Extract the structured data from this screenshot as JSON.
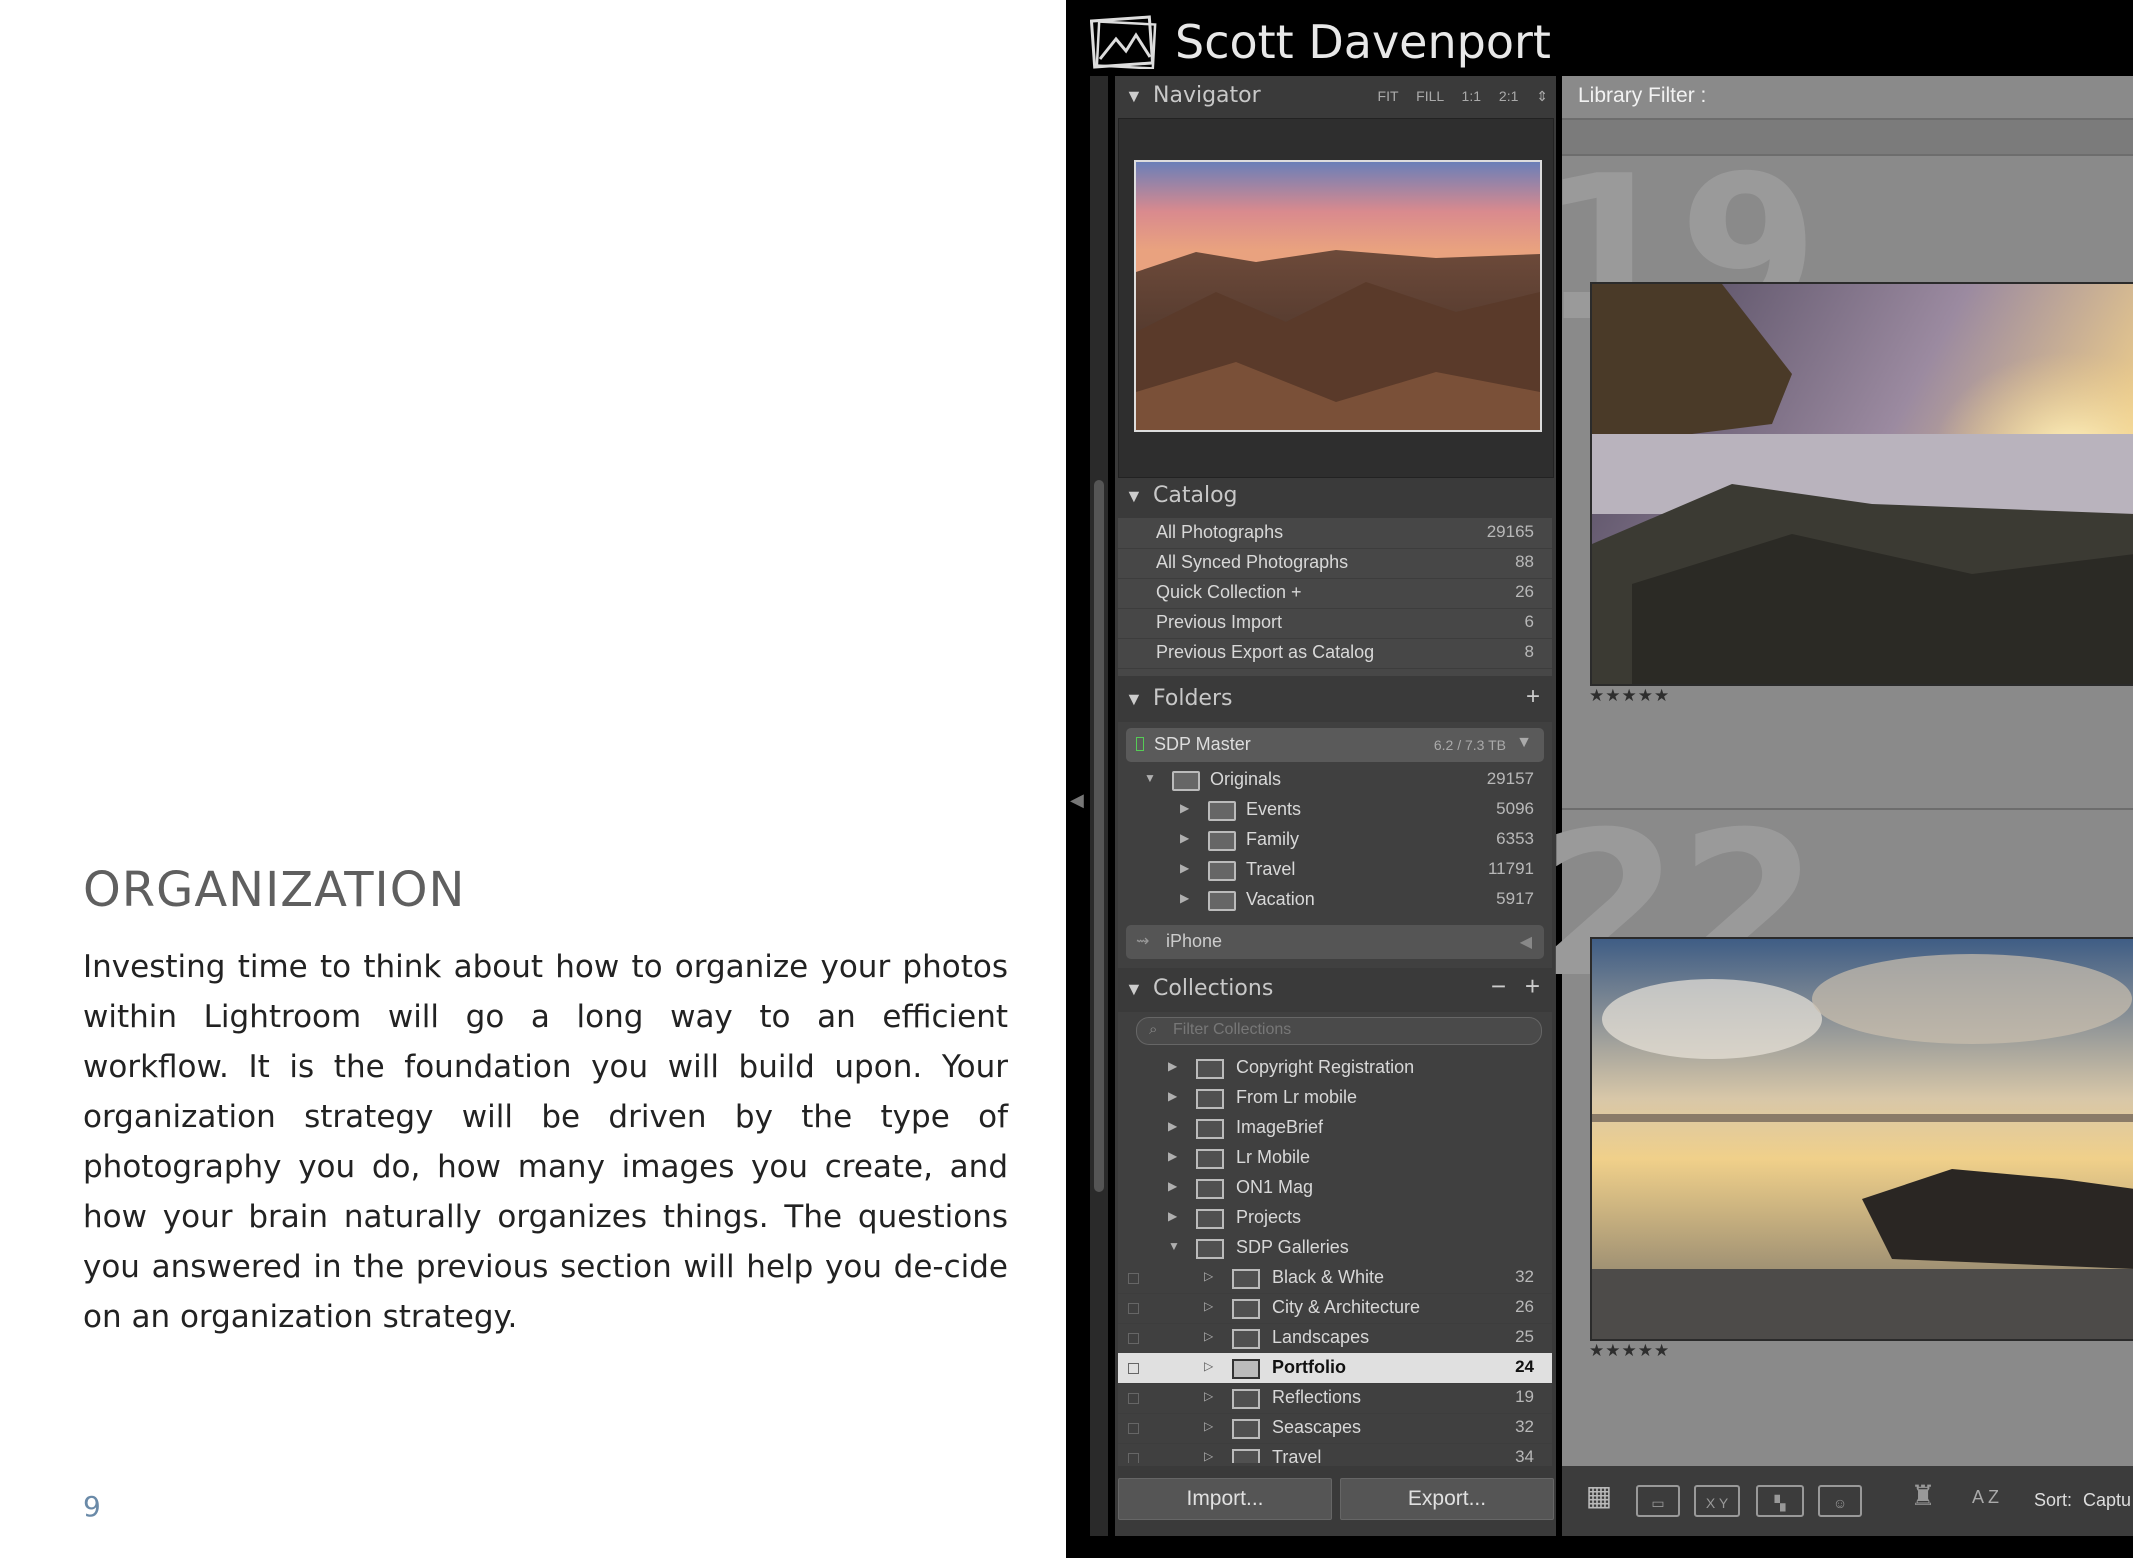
{
  "document": {
    "heading": "ORGANIZATION",
    "body": "Investing time to think about how to organize your photos within Lightroom will go a long way to an efficient workflow. It is the foundation you will build upon. Your organization strategy will be driven by the type of photography you do, how many images you create, and how your brain naturally organizes things. The questions you answered in the previous section will help you de-cide on an organization strategy.",
    "page_number": "9"
  },
  "lightroom": {
    "identity_plate": "Scott Davenport",
    "navigator": {
      "title": "Navigator",
      "options": [
        "FIT",
        "FILL",
        "1:1",
        "2:1"
      ]
    },
    "catalog": {
      "title": "Catalog",
      "items": [
        {
          "label": "All Photographs",
          "count": "29165"
        },
        {
          "label": "All Synced Photographs",
          "count": "88"
        },
        {
          "label": "Quick Collection +",
          "count": "26"
        },
        {
          "label": "Previous Import",
          "count": "6"
        },
        {
          "label": "Previous Export as Catalog",
          "count": "8"
        }
      ]
    },
    "folders": {
      "title": "Folders",
      "add": "+",
      "volume": {
        "name": "SDP Master",
        "usage": "6.2 / 7.3 TB"
      },
      "items": [
        {
          "label": "Originals",
          "count": "29157"
        },
        {
          "label": "Events",
          "count": "5096"
        },
        {
          "label": "Family",
          "count": "6353"
        },
        {
          "label": "Travel",
          "count": "11791"
        },
        {
          "label": "Vacation",
          "count": "5917"
        }
      ],
      "second_volume": "iPhone"
    },
    "collections": {
      "title": "Collections",
      "minus": "−",
      "add": "+",
      "filter_placeholder": "Filter Collections",
      "sets": [
        {
          "label": "Copyright Registration"
        },
        {
          "label": "From Lr mobile"
        },
        {
          "label": "ImageBrief"
        },
        {
          "label": "Lr Mobile"
        },
        {
          "label": "ON1 Mag"
        },
        {
          "label": "Projects"
        },
        {
          "label": "SDP Galleries"
        }
      ],
      "children": [
        {
          "label": "Black & White",
          "count": "32"
        },
        {
          "label": "City & Architecture",
          "count": "26"
        },
        {
          "label": "Landscapes",
          "count": "25"
        },
        {
          "label": "Portfolio",
          "count": "24"
        },
        {
          "label": "Reflections",
          "count": "19"
        },
        {
          "label": "Seascapes",
          "count": "32"
        },
        {
          "label": "Travel",
          "count": "34"
        }
      ]
    },
    "buttons": {
      "import": "Import...",
      "export": "Export..."
    },
    "library_filter": "Library Filter :",
    "grid": {
      "cells": [
        {
          "index": "19",
          "stars": "★★★★★"
        },
        {
          "index": "22",
          "stars": "★★★★★"
        }
      ]
    },
    "toolbar": {
      "sort_label": "Sort:",
      "sort_value": "Captu",
      "az": "A Z"
    }
  }
}
